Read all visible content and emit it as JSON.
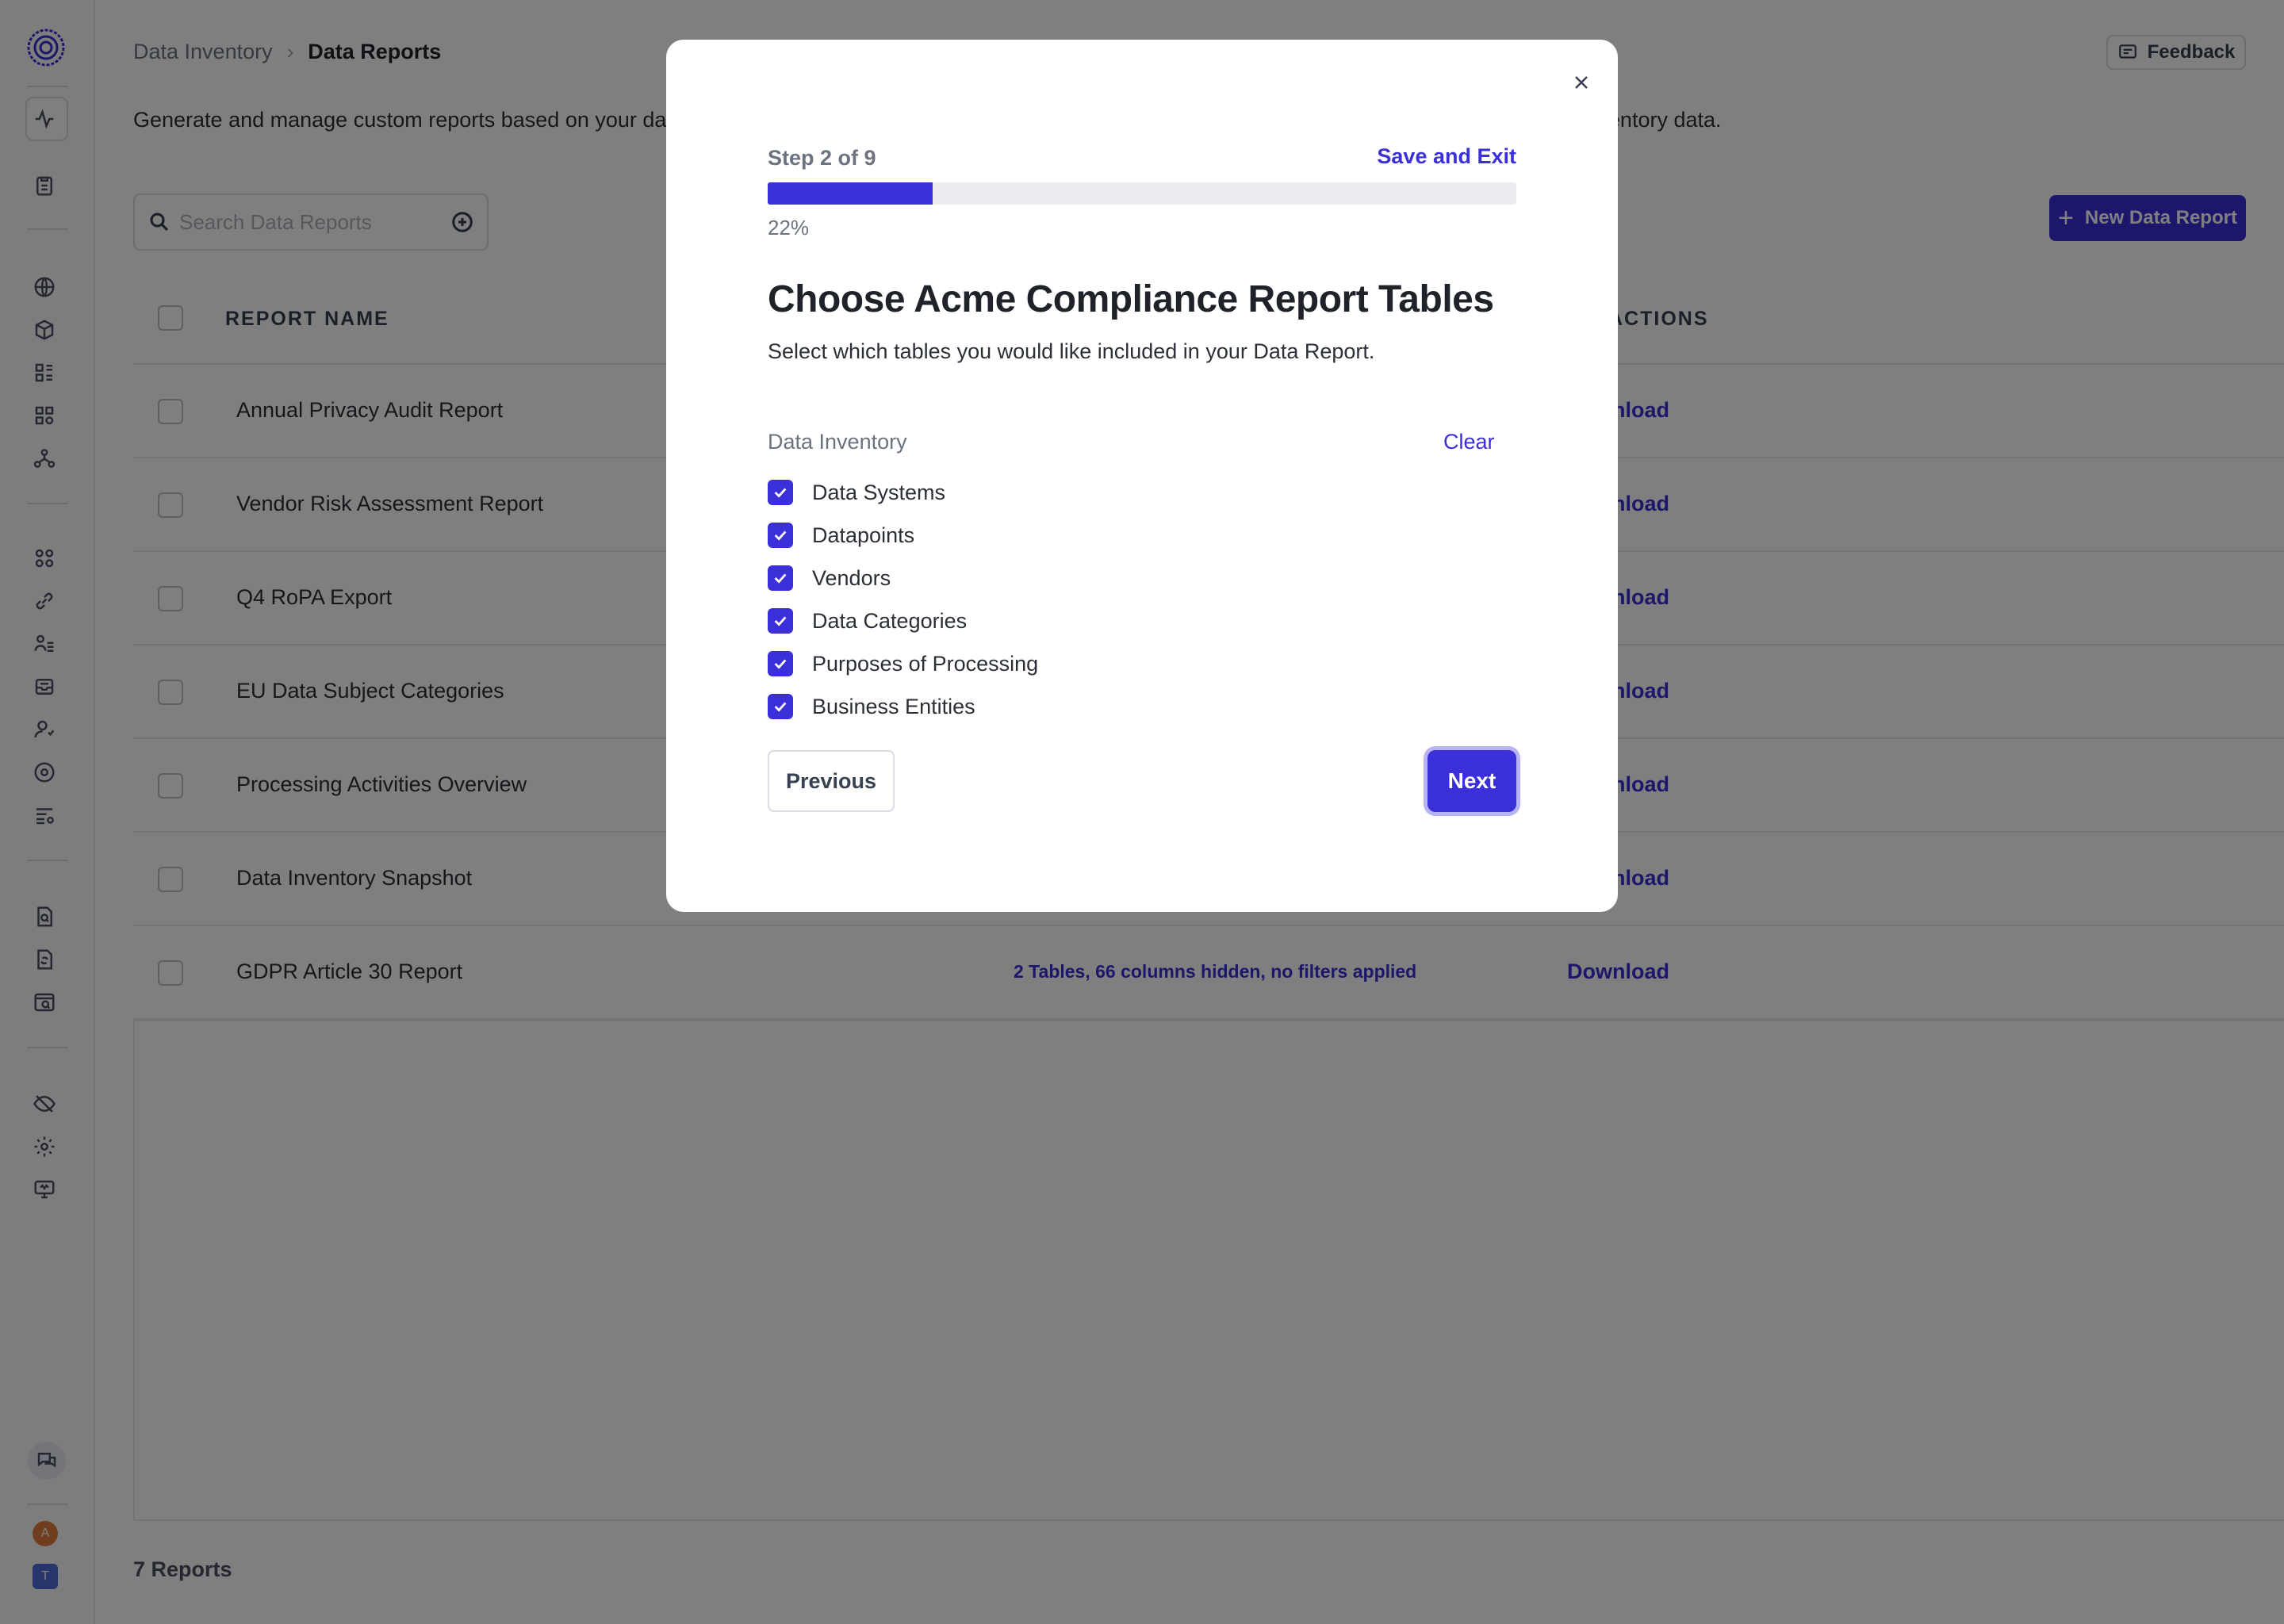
{
  "breadcrumb": {
    "parent": "Data Inventory",
    "separator": "›",
    "current": "Data Reports"
  },
  "feedback": {
    "label": "Feedback",
    "icon": "message-square-icon"
  },
  "page": {
    "description": "Generate and manage custom reports based on your data inventory. Export reports in various formats for compliance (such as ROPA or DPIA) based on inventory data."
  },
  "search": {
    "placeholder": "Search Data Reports"
  },
  "new_report": {
    "label": "New Data Report"
  },
  "table": {
    "headers": {
      "name": "REPORT NAME",
      "actions": "ACTIONS"
    },
    "rows": [
      {
        "name": "Annual Privacy Audit Report",
        "summary": "",
        "action": "Download"
      },
      {
        "name": "Vendor Risk Assessment Report",
        "summary": "",
        "action": "Download"
      },
      {
        "name": "Q4 RoPA Export",
        "summary": "",
        "action": "Download"
      },
      {
        "name": "EU Data Subject Categories",
        "summary": "",
        "action": "Download"
      },
      {
        "name": "Processing Activities Overview",
        "summary": "",
        "action": "Download"
      },
      {
        "name": "Data Inventory Snapshot",
        "summary": "",
        "action": "Download"
      },
      {
        "name": "GDPR Article 30 Report",
        "summary": "2 Tables, 66 columns hidden, no filters applied",
        "action": "Download"
      }
    ]
  },
  "footer": {
    "count": "7 Reports"
  },
  "sidebar": {
    "avatars": [
      {
        "letter": "A",
        "color": "#e07a3c"
      },
      {
        "letter": "T",
        "color": "#4f6bd8"
      }
    ]
  },
  "modal": {
    "step": "Step 2 of 9",
    "save_exit": "Save and Exit",
    "progress": 22,
    "progress_label": "22%",
    "title": "Choose Acme Compliance Report Tables",
    "subtitle": "Select which tables you would like included in your Data Report.",
    "group_label": "Data Inventory",
    "clear": "Clear",
    "options": [
      {
        "label": "Data Systems",
        "checked": true
      },
      {
        "label": "Datapoints",
        "checked": true
      },
      {
        "label": "Vendors",
        "checked": true
      },
      {
        "label": "Data Categories",
        "checked": true
      },
      {
        "label": "Purposes of Processing",
        "checked": true
      },
      {
        "label": "Business Entities",
        "checked": true
      }
    ],
    "previous": "Previous",
    "next": "Next"
  },
  "colors": {
    "accent": "#3a2fd8",
    "overlay": "rgba(0,0,0,0.5)"
  }
}
